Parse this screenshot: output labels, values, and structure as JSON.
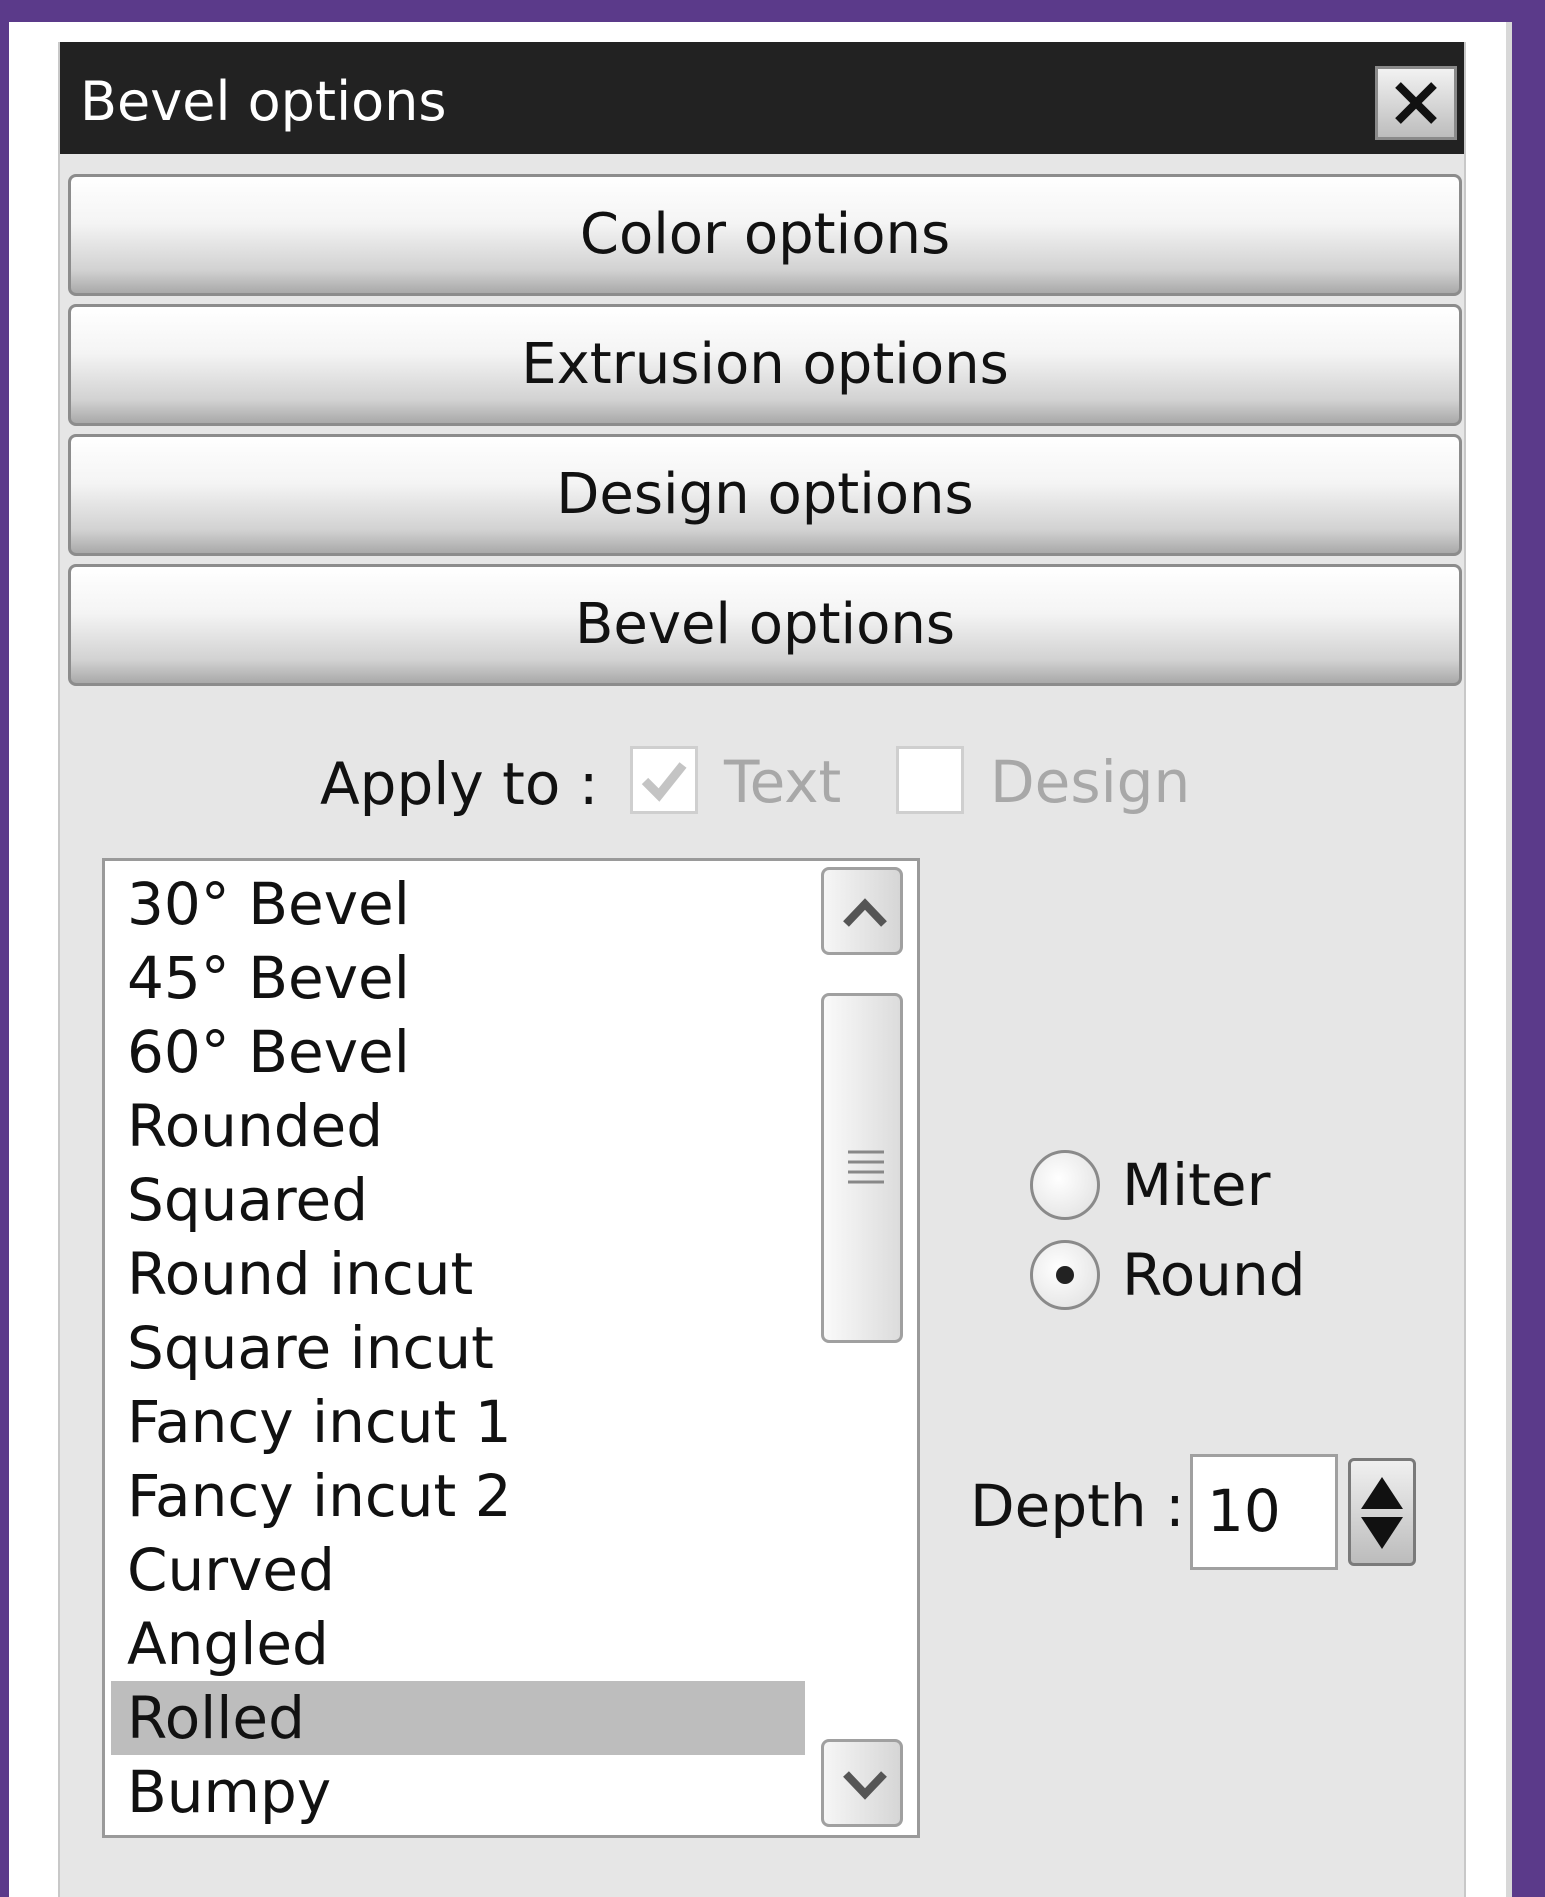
{
  "window": {
    "title": "Bevel options",
    "close_icon": "close-x-icon"
  },
  "sections": [
    {
      "label": "Color options"
    },
    {
      "label": "Extrusion options"
    },
    {
      "label": "Design options"
    },
    {
      "label": "Bevel options"
    }
  ],
  "apply_to": {
    "label": "Apply to :",
    "text": {
      "label": "Text",
      "checked": true,
      "enabled": false
    },
    "design": {
      "label": "Design",
      "checked": false,
      "enabled": false
    }
  },
  "bevel_list": {
    "items": [
      "30° Bevel",
      "45° Bevel",
      "60° Bevel",
      "Rounded",
      "Squared",
      "Round incut",
      "Square incut",
      "Fancy incut 1",
      "Fancy incut 2",
      "Curved",
      "Angled",
      "Rolled",
      "Bumpy"
    ],
    "selected": "Rolled"
  },
  "corner": {
    "options": [
      {
        "label": "Miter",
        "selected": false
      },
      {
        "label": "Round",
        "selected": true
      }
    ]
  },
  "depth": {
    "label": "Depth :",
    "value": "10"
  },
  "colors": {
    "frame": "#5b3a8a",
    "titlebar": "#222222",
    "panel": "#e6e6e6",
    "selection": "#bdbdbd"
  }
}
